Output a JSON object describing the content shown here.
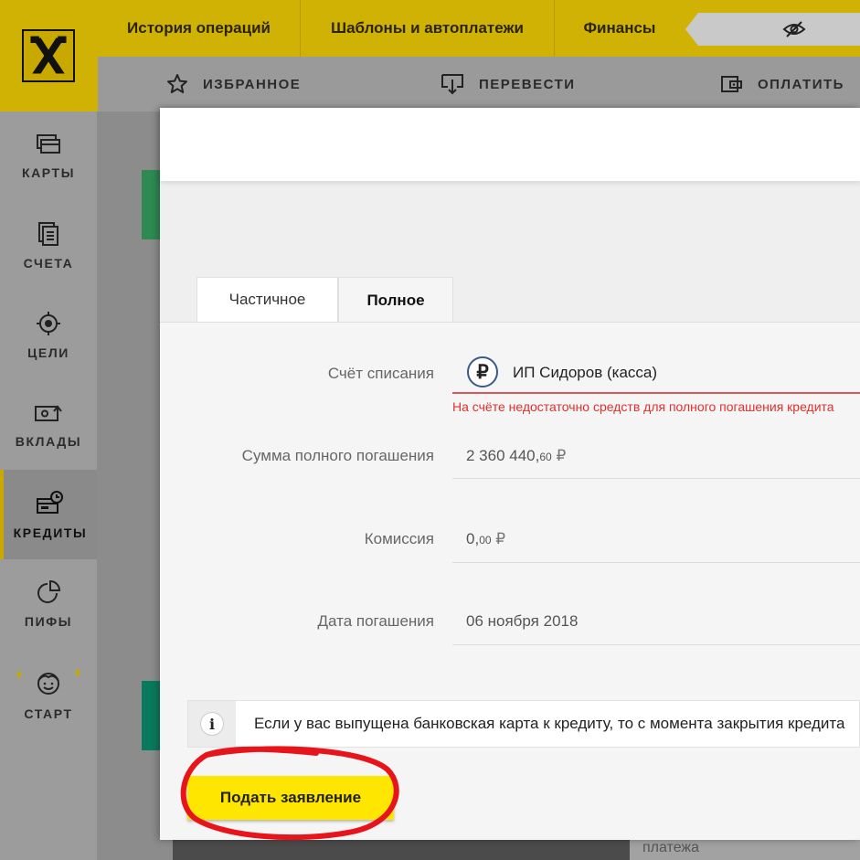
{
  "topnav": {
    "items": [
      {
        "label": "История операций"
      },
      {
        "label": "Шаблоны и автоплатежи"
      },
      {
        "label": "Финансы"
      }
    ]
  },
  "subnav": {
    "favorites": "ИЗБРАННОЕ",
    "transfer": "ПЕРЕВЕСТИ",
    "pay": "ОПЛАТИТЬ"
  },
  "sidebar": {
    "items": [
      {
        "label": "КАРТЫ",
        "icon": "cards-icon"
      },
      {
        "label": "СЧЕТА",
        "icon": "accounts-icon"
      },
      {
        "label": "ЦЕЛИ",
        "icon": "target-icon"
      },
      {
        "label": "ВКЛАДЫ",
        "icon": "deposits-icon"
      },
      {
        "label": "КРЕДИТЫ",
        "icon": "credits-icon",
        "active": true
      },
      {
        "label": "ПИФЫ",
        "icon": "pie-chart-icon"
      },
      {
        "label": "СТАРТ",
        "icon": "smiley-face-icon"
      }
    ]
  },
  "modal": {
    "tabs": [
      {
        "label": "Частичное",
        "active": false
      },
      {
        "label": "Полное",
        "active": true
      }
    ],
    "account": {
      "label": "Счёт списания",
      "currency_symbol": "₽",
      "name": "ИП Сидоров (касса)",
      "error": "На счёте недостаточно средств для полного погашения кредита"
    },
    "full_amount": {
      "label": "Сумма полного погашения",
      "integer": "2 360 440,",
      "fraction": "60",
      "currency": "₽"
    },
    "commission": {
      "label": "Комиссия",
      "integer": "0,",
      "fraction": "00",
      "currency": "₽"
    },
    "repayment_date": {
      "label": "Дата погашения",
      "value": "06 ноября 2018"
    },
    "info": {
      "icon": "info-icon",
      "text": "Если у вас выпущена банковская карта к кредиту, то с момента закрытия кредита"
    },
    "submit_label": "Подать заявление"
  },
  "background": {
    "bottom_right_text": "платежа"
  },
  "colors": {
    "brand_yellow": "#ffe600",
    "error": "#e0302c",
    "annotation": "#e8141c"
  }
}
